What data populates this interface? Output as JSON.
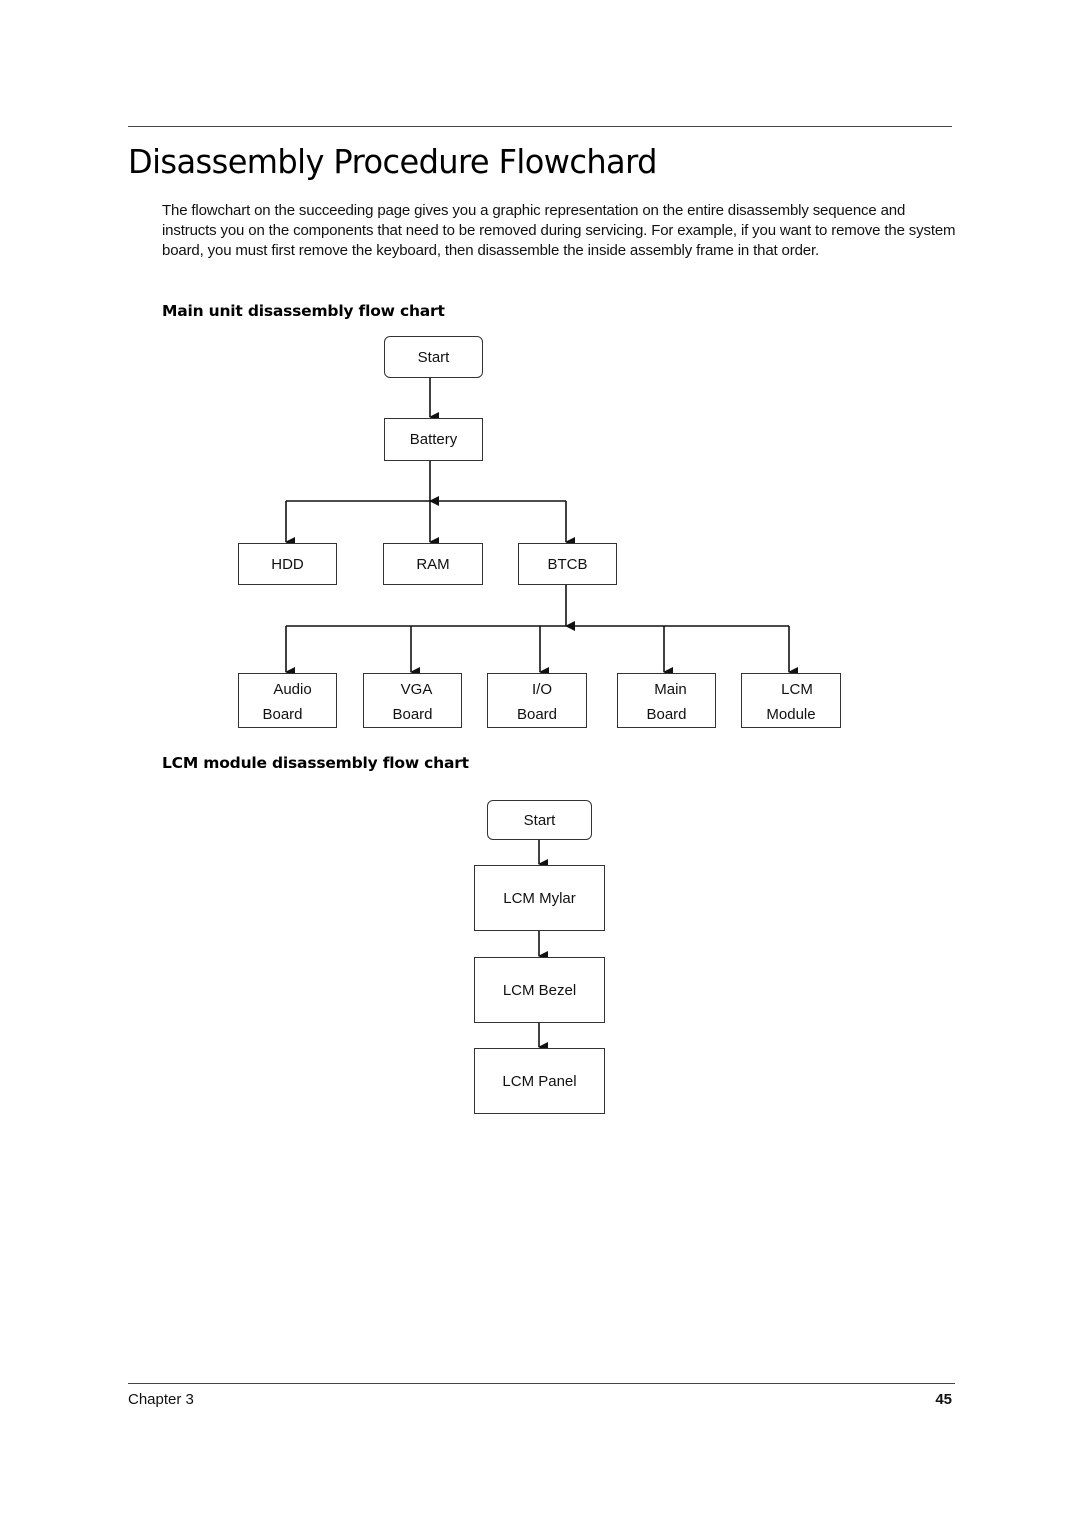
{
  "page": {
    "title": "Disassembly Procedure Flowchard",
    "intro": "The flowchart on the succeeding page gives you a graphic representation on the entire disassembly sequence and instructs you on the components that need to be removed during servicing. For example, if you want to remove the system board, you must first remove the keyboard, then disassemble the inside assembly frame in that order."
  },
  "main_chart": {
    "heading": "Main unit disassembly flow chart",
    "start": "Start",
    "battery": "Battery",
    "level2": [
      "HDD",
      "RAM",
      "BTCB"
    ],
    "level3": [
      {
        "line1": "Audio",
        "line2": "Board"
      },
      {
        "line1": "VGA",
        "line2": "Board"
      },
      {
        "line1": "I/O",
        "line2": "Board"
      },
      {
        "line1": "Main",
        "line2": "Board"
      },
      {
        "line1": "LCM",
        "line2": "Module"
      }
    ]
  },
  "lcm_chart": {
    "heading": "LCM module disassembly flow chart",
    "steps": [
      "Start",
      "LCM Mylar",
      "LCM Bezel",
      "LCM Panel"
    ]
  },
  "footer": {
    "chapter": "Chapter 3",
    "page_number": "45"
  }
}
